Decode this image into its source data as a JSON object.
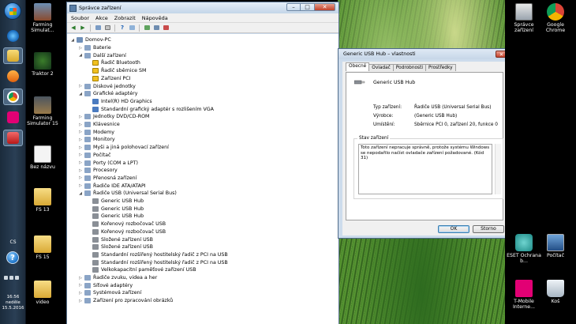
{
  "taskbar": {
    "language": "CS",
    "clock_time": "16:56",
    "clock_day": "neděle",
    "clock_date": "15.5.2016",
    "buttons": [
      "explorer",
      "internet-explorer",
      "file-explorer",
      "media-player",
      "chrome",
      "tmobile",
      "app-red"
    ]
  },
  "desktop_icons": {
    "farming_simulator": "Farming Simulat...",
    "traktor": "Traktor 2",
    "farming_simulator_15": "Farming Simulator 15",
    "bez_nazvu": "Bez názvu",
    "fs13": "FS 13",
    "fs15": "FS 15",
    "video": "video",
    "spravce": "Správce zařízení",
    "chrome": "Google Chrome",
    "eset": "ESET Ochrana b...",
    "pocitac": "Počítač",
    "tmobile": "T-Mobile Interne...",
    "kos": "Koš"
  },
  "device_manager": {
    "title": "Správce zařízení",
    "menu": [
      "Soubor",
      "Akce",
      "Zobrazit",
      "Nápověda"
    ],
    "tree": [
      {
        "label": "Domov-PC",
        "level": 0,
        "expander": "◢"
      },
      {
        "label": "Baterie",
        "level": 1,
        "expander": "▷"
      },
      {
        "label": "Další zařízení",
        "level": 1,
        "expander": "◢"
      },
      {
        "label": "Řadič Bluetooth",
        "level": 2,
        "expander": ""
      },
      {
        "label": "Řadič sběrnice SM",
        "level": 2,
        "expander": ""
      },
      {
        "label": "Zařízení PCI",
        "level": 2,
        "expander": ""
      },
      {
        "label": "Diskové jednotky",
        "level": 1,
        "expander": "▷"
      },
      {
        "label": "Grafické adaptéry",
        "level": 1,
        "expander": "◢"
      },
      {
        "label": "Intel(R) HD Graphics",
        "level": 2,
        "expander": ""
      },
      {
        "label": "Standardní grafický adaptér s rozlišením VGA",
        "level": 2,
        "expander": ""
      },
      {
        "label": "Jednotky DVD/CD-ROM",
        "level": 1,
        "expander": "▷"
      },
      {
        "label": "Klávesnice",
        "level": 1,
        "expander": "▷"
      },
      {
        "label": "Modemy",
        "level": 1,
        "expander": "▷"
      },
      {
        "label": "Monitory",
        "level": 1,
        "expander": "▷"
      },
      {
        "label": "Myši a jiná polohovací zařízení",
        "level": 1,
        "expander": "▷"
      },
      {
        "label": "Počítač",
        "level": 1,
        "expander": "▷"
      },
      {
        "label": "Porty (COM a LPT)",
        "level": 1,
        "expander": "▷"
      },
      {
        "label": "Procesory",
        "level": 1,
        "expander": "▷"
      },
      {
        "label": "Přenosná zařízení",
        "level": 1,
        "expander": "▷"
      },
      {
        "label": "Řadiče IDE ATA/ATAPI",
        "level": 1,
        "expander": "▷"
      },
      {
        "label": "Řadiče USB (Universal Serial Bus)",
        "level": 1,
        "expander": "◢"
      },
      {
        "label": "Generic USB Hub",
        "level": 2,
        "expander": ""
      },
      {
        "label": "Generic USB Hub",
        "level": 2,
        "expander": ""
      },
      {
        "label": "Generic USB Hub",
        "level": 2,
        "expander": ""
      },
      {
        "label": "Kořenový rozbočovač USB",
        "level": 2,
        "expander": ""
      },
      {
        "label": "Kořenový rozbočovač USB",
        "level": 2,
        "expander": ""
      },
      {
        "label": "Složené zařízení USB",
        "level": 2,
        "expander": ""
      },
      {
        "label": "Složené zařízení USB",
        "level": 2,
        "expander": ""
      },
      {
        "label": "Standardní rozšířený hostitelský řadič z PCI na USB",
        "level": 2,
        "expander": ""
      },
      {
        "label": "Standardní rozšířený hostitelský řadič z PCI na USB",
        "level": 2,
        "expander": ""
      },
      {
        "label": "Velkokapacitní paměťové zařízení USB",
        "level": 2,
        "expander": ""
      },
      {
        "label": "Řadiče zvuku, videa a her",
        "level": 1,
        "expander": "▷"
      },
      {
        "label": "Síťové adaptéry",
        "level": 1,
        "expander": "▷"
      },
      {
        "label": "Systémová zařízení",
        "level": 1,
        "expander": "▷"
      },
      {
        "label": "Zařízení pro zpracování obrázků",
        "level": 1,
        "expander": "▷"
      }
    ]
  },
  "properties_dialog": {
    "title": "Generic USB Hub – vlastnosti",
    "tabs": [
      "Obecné",
      "Ovladač",
      "Podrobnosti",
      "Prostředky"
    ],
    "device_name": "Generic USB Hub",
    "device_type_label": "Typ zařízení:",
    "device_type_value": "Řadiče USB (Universal Serial Bus)",
    "manufacturer_label": "Výrobce:",
    "manufacturer_value": "(Generic USB Hub)",
    "location_label": "Umístění:",
    "location_value": "Sběrnice PCI 0, zařízení 20, funkce 0",
    "status_legend": "Stav zařízení",
    "status_text": "Toto zařízení nepracuje správně, protože systému Windows se nepodařilo načíst ovladače zařízení požadované. (Kód 31)",
    "ok_label": "OK",
    "cancel_label": "Storno"
  },
  "colors": {
    "folder": "#e8c458",
    "warning": "#f0c020",
    "usb": "#8a8f96",
    "display": "#4a7bc0"
  }
}
